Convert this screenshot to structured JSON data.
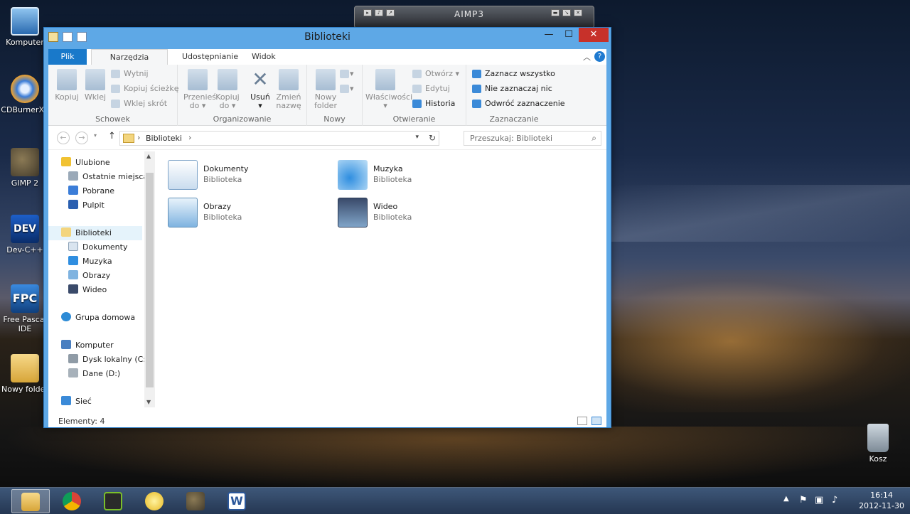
{
  "desktop": {
    "icons": [
      {
        "label": "Komputer"
      },
      {
        "label": "CDBurnerXP"
      },
      {
        "label": "GIMP 2"
      },
      {
        "label": "Dev-C++"
      },
      {
        "label": "Free Pascal IDE"
      },
      {
        "label": "Nowy folder"
      },
      {
        "label": "Kosz"
      }
    ]
  },
  "aimp": {
    "title": "AIMP3"
  },
  "window": {
    "title": "Biblioteki",
    "controls": {
      "minimize": "—",
      "maximize": "☐",
      "close": "✕"
    }
  },
  "ribbon": {
    "tabs": [
      "Plik",
      "Narzędzia główne",
      "Udostępnianie",
      "Widok"
    ],
    "groups": {
      "schowek": {
        "label": "Schowek",
        "kopiuj": "Kopiuj",
        "wklej": "Wklej",
        "wytnij": "Wytnij",
        "kopiuj_sciezke": "Kopiuj ścieżkę",
        "wklej_skrot": "Wklej skrót"
      },
      "organizowanie": {
        "label": "Organizowanie",
        "przenies_l1": "Przenieś",
        "przenies_l2": "do ▾",
        "kopiuj_l1": "Kopiuj",
        "kopiuj_l2": "do ▾",
        "usun": "Usuń",
        "zmien_l1": "Zmień",
        "zmien_l2": "nazwę"
      },
      "nowy": {
        "label": "Nowy",
        "nowy_l1": "Nowy",
        "nowy_l2": "folder"
      },
      "otwieranie": {
        "label": "Otwieranie",
        "wlasciwosci": "Właściwości",
        "otworz": "Otwórz ▾",
        "edytuj": "Edytuj",
        "historia": "Historia"
      },
      "zaznaczanie": {
        "label": "Zaznaczanie",
        "zaznacz_wszystko": "Zaznacz wszystko",
        "nie_zaznaczaj": "Nie zaznaczaj nic",
        "odwroc": "Odwróć zaznaczenie"
      }
    }
  },
  "address": {
    "path": "Biblioteki",
    "search_placeholder": "Przeszukaj: Biblioteki"
  },
  "nav_pane": {
    "items": [
      {
        "label": "Ulubione",
        "color": "#f1c232"
      },
      {
        "label": "Ostatnie miejsca",
        "color": "#9aa9b8"
      },
      {
        "label": "Pobrane",
        "color": "#3b7dd8"
      },
      {
        "label": "Pulpit",
        "color": "#2a5fb0"
      },
      {
        "label": "Biblioteki",
        "color": "#f3d57e"
      },
      {
        "label": "Dokumenty",
        "color": "#d9e4ef"
      },
      {
        "label": "Muzyka",
        "color": "#2f8ee0"
      },
      {
        "label": "Obrazy",
        "color": "#7fb3e0"
      },
      {
        "label": "Wideo",
        "color": "#3a4a6a"
      },
      {
        "label": "Grupa domowa",
        "color": "#2d8bd6"
      },
      {
        "label": "Komputer",
        "color": "#4a7fc0"
      },
      {
        "label": "Dysk lokalny (C:)",
        "color": "#8f9ba6"
      },
      {
        "label": "Dane (D:)",
        "color": "#a7b1ba"
      },
      {
        "label": "Sieć",
        "color": "#3b8ad8"
      }
    ]
  },
  "libraries": [
    {
      "name": "Dokumenty",
      "type": "Biblioteka"
    },
    {
      "name": "Muzyka",
      "type": "Biblioteka"
    },
    {
      "name": "Obrazy",
      "type": "Biblioteka"
    },
    {
      "name": "Wideo",
      "type": "Biblioteka"
    }
  ],
  "status": {
    "items": "Elementy: 4"
  },
  "taskbar": {
    "apps": [
      "explorer",
      "chrome",
      "aimp",
      "tips",
      "gimp",
      "word"
    ],
    "clock_time": "16:14",
    "clock_date": "2012-11-30"
  }
}
